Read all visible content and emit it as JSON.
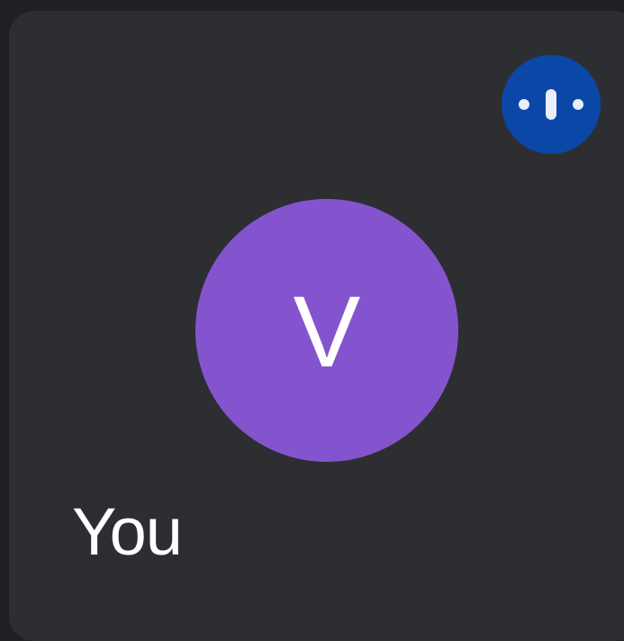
{
  "participant": {
    "avatar_initial": "V",
    "name": "You",
    "speaking_indicator_icon": "audio-levels-icon"
  },
  "colors": {
    "page_background": "#1f2023",
    "tile_background": "#2d2e31",
    "avatar_background": "#8454cf",
    "speaking_badge_background": "#0b47a6",
    "text": "#ffffff"
  }
}
